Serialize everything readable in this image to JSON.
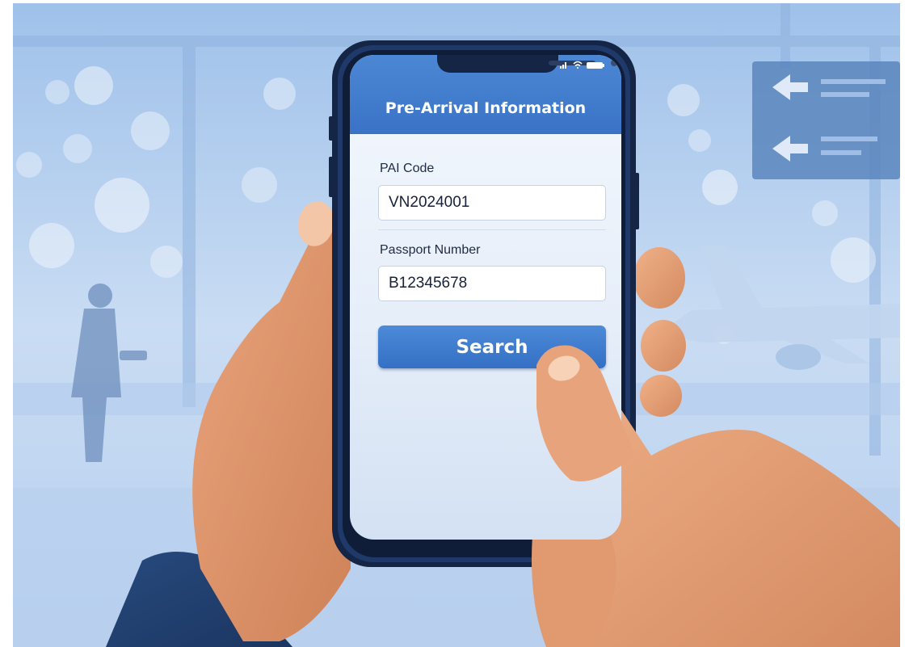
{
  "app": {
    "title": "Pre-Arrival Information"
  },
  "form": {
    "pai_code_label": "PAI Code",
    "pai_code_value": "VN2024001",
    "passport_label": "Passport Number",
    "passport_value": "B12345678",
    "search_label": "Search"
  },
  "status_bar": {
    "icons": [
      "signal-icon",
      "wifi-icon",
      "battery-icon"
    ]
  },
  "colors": {
    "header_blue": "#3a73c6",
    "button_blue": "#3470c4",
    "phone_frame": "#142545"
  }
}
